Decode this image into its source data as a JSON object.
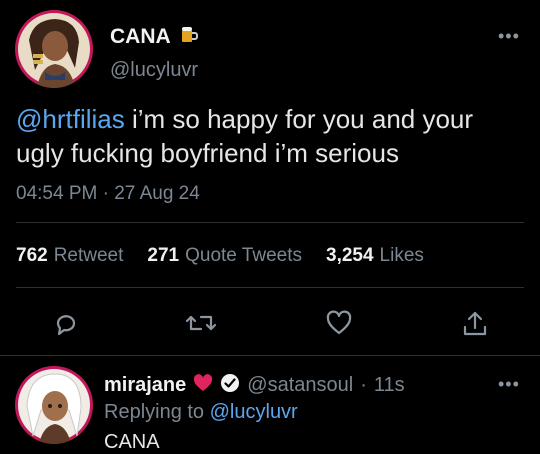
{
  "tweet": {
    "author_name": "CANA",
    "author_handle": "@lucyluvr",
    "author_emoji_icon": "beer-mug-icon",
    "menu_icon": "more-dots",
    "text_mention": "@hrtfilias",
    "text_body": " i’m so happy for you and your ugly fucking boyfriend i’m serious",
    "time": "04:54 PM",
    "separator": "·",
    "date": "27 Aug 24",
    "stats": {
      "retweets_count": "762",
      "retweets_label": "Retweet",
      "quotes_count": "271",
      "quotes_label": "Quote Tweets",
      "likes_count": "3,254",
      "likes_label": "Likes"
    },
    "actions": [
      "reply-icon",
      "retweet-icon",
      "like-icon",
      "share-icon"
    ]
  },
  "reply": {
    "author_name": "mirajane",
    "heart_icon": "red-heart-icon",
    "verified_icon": "check-circle-icon",
    "author_handle": "@satansoul",
    "separator": "·",
    "time": "11s",
    "replying_label": "Replying to",
    "replying_handle": "@lucyluvr",
    "text": "CANA",
    "menu_icon": "more-dots"
  },
  "colors": {
    "background": "#000000",
    "accent": "#5aa7f0",
    "muted": "#7c8791",
    "avatar_border": "#c2185b",
    "heart": "#e0245e"
  }
}
